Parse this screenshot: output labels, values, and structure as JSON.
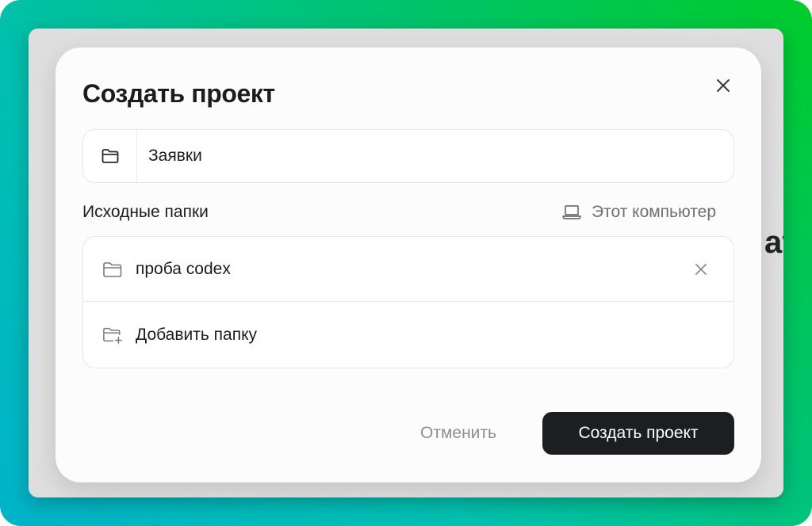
{
  "background": {
    "heading_fragment": "ат"
  },
  "dialog": {
    "title": "Создать проект",
    "project_name": {
      "value": "Заявки",
      "icon": "folder-icon"
    },
    "source_folders": {
      "label": "Исходные папки",
      "location": {
        "label": "Этот компьютер",
        "icon": "laptop-icon"
      },
      "items": [
        {
          "name": "проба codex",
          "icon": "folder-icon",
          "remove_icon": "close-icon"
        }
      ],
      "add_label": "Добавить папку",
      "add_icon": "folder-plus-icon"
    },
    "buttons": {
      "cancel": "Отменить",
      "create": "Создать проект"
    }
  },
  "colors": {
    "gradient_start": "#00b3c9",
    "gradient_end": "#00cc2a",
    "primary_button": "#1c1e21",
    "muted_text": "#8e8e8e"
  }
}
